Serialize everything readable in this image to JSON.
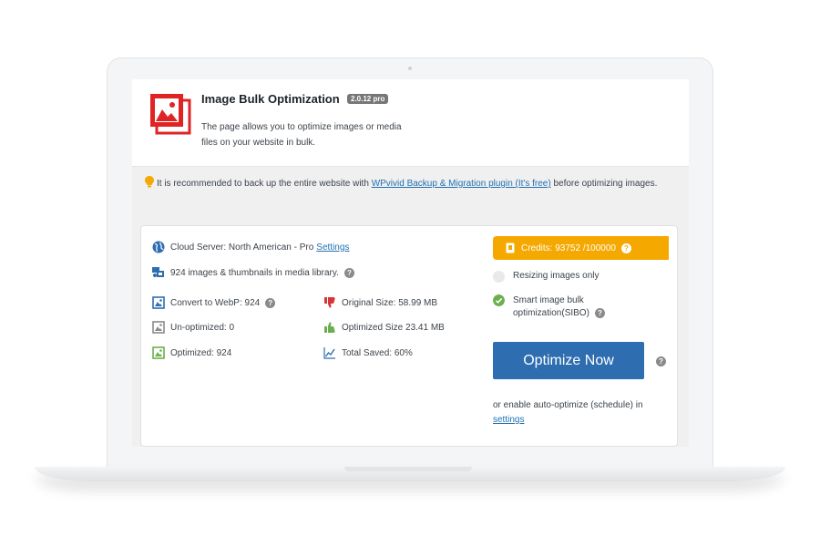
{
  "header": {
    "title": "Image Bulk Optimization",
    "version": "2.0.12 pro",
    "description": "The page allows you to optimize images or media files on your website in bulk."
  },
  "notice": {
    "text_before": "It is recommended to back up the entire website with ",
    "link_text": "WPvivid Backup & Migration plugin (It's free)",
    "text_after": " before optimizing images."
  },
  "server": {
    "label": "Cloud Server: North American - Pro",
    "settings_link": "Settings"
  },
  "library": {
    "text": "924 images & thumbnails in media library."
  },
  "stats_left": [
    {
      "label": "Convert to WebP: 924",
      "icon": "image-webp-icon"
    },
    {
      "label": "Un-optimized: 0",
      "icon": "image-unoptimized-icon"
    },
    {
      "label": "Optimized: 924",
      "icon": "image-optimized-icon"
    }
  ],
  "stats_right": [
    {
      "label": "Original Size: 58.99 MB",
      "icon": "thumbs-down-icon"
    },
    {
      "label": "Optimized Size 23.41 MB",
      "icon": "thumbs-up-icon"
    },
    {
      "label": "Total Saved: 60%",
      "icon": "trend-chart-icon"
    }
  ],
  "credits": {
    "label": "Credits: 93752 /100000"
  },
  "options": {
    "resize_label": "Resizing images only",
    "resize_checked": false,
    "sibo_label": "Smart image bulk optimization(SIBO)",
    "sibo_checked": true
  },
  "actions": {
    "optimize_label": "Optimize Now",
    "auto_text": "or enable auto-optimize (schedule) in",
    "auto_link": "settings"
  },
  "colors": {
    "accent_blue": "#2d6db0",
    "credits_orange": "#f5a800",
    "logo_red": "#e02424",
    "check_green": "#6ab04c"
  }
}
